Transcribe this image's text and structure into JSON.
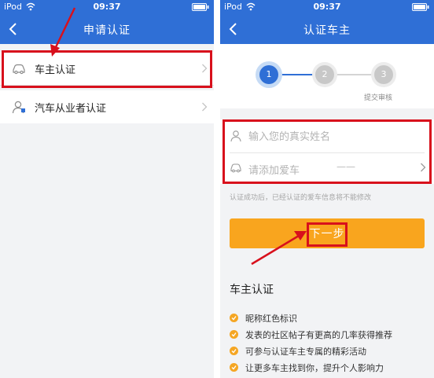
{
  "status_bar": {
    "carrier": "iPod",
    "time": "09:37"
  },
  "left_screen": {
    "nav_title": "申请认证",
    "rows": [
      {
        "label": "车主认证",
        "icon": "car-icon"
      },
      {
        "label": "汽车从业者认证",
        "icon": "user-icon"
      }
    ]
  },
  "right_screen": {
    "nav_title": "认证车主",
    "steps": {
      "labels": [
        "1",
        "2",
        "3"
      ],
      "current": 1,
      "caption": "提交审核"
    },
    "form": {
      "name_placeholder": "输入您的真实姓名",
      "car_placeholder": "请添加爱车",
      "car_dash": "——"
    },
    "notice": "认证成功后，已经认证的爱车信息将不能修改",
    "next_button": "下一步",
    "benefits": {
      "title": "车主认证",
      "items": [
        "昵称红色标识",
        "发表的社区帖子有更高的几率获得推荐",
        "可参与认证车主专属的精彩活动",
        "让更多车主找到你，提升个人影响力"
      ]
    }
  },
  "colors": {
    "nav_blue": "#2f6fd6",
    "highlight_red": "#d8101c",
    "button_orange": "#f9a51e",
    "bullet_orange": "#f5a623"
  }
}
